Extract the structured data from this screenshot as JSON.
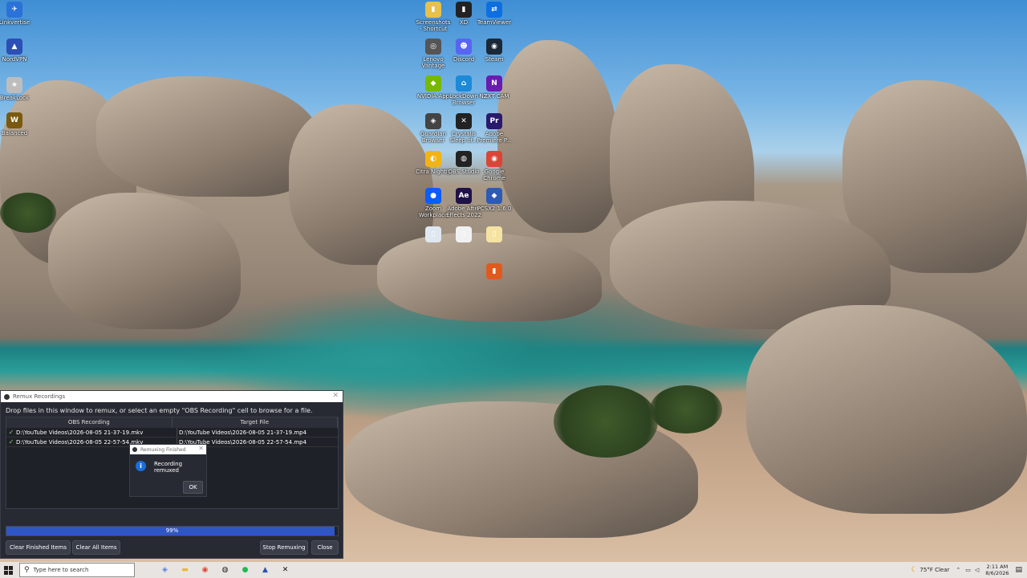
{
  "desktop_icons": [
    {
      "label": "Linkvertise",
      "name": "app-icon-1",
      "glyph": "✈",
      "color": "#2a72d8"
    },
    {
      "label": "NordVPN",
      "name": "nordvpn-icon",
      "glyph": "▲",
      "color": "#2b4fb5"
    },
    {
      "label": "BreakLock",
      "name": "app-icon-3",
      "glyph": "★",
      "color": "#bdbdbd"
    },
    {
      "label": "Balanced",
      "name": "app-icon-4",
      "glyph": "W",
      "color": "#7a5a10"
    },
    {
      "label": "Screenshots - Shortcut",
      "name": "folder-icon",
      "glyph": "▮",
      "color": "#e8c04a"
    },
    {
      "label": "XD",
      "name": "file-icon",
      "glyph": "▮",
      "color": "#222"
    },
    {
      "label": "TeamViewer",
      "name": "teamviewer-icon",
      "glyph": "⇄",
      "color": "#0e6fe0"
    },
    {
      "label": "Lenovo Vantage",
      "name": "vantage-icon",
      "glyph": "◎",
      "color": "#555"
    },
    {
      "label": "Discord",
      "name": "discord-icon",
      "glyph": "☻",
      "color": "#5865f2"
    },
    {
      "label": "Steam",
      "name": "steam-icon",
      "glyph": "◉",
      "color": "#1b2838"
    },
    {
      "label": "NVIDIA App",
      "name": "nvidia-icon",
      "glyph": "◆",
      "color": "#76b900"
    },
    {
      "label": "LockDown Browser",
      "name": "lockdown-icon",
      "glyph": "⌂",
      "color": "#1c8ad8"
    },
    {
      "label": "NZXT CAM",
      "name": "nzxt-icon",
      "glyph": "N",
      "color": "#6a1bb0"
    },
    {
      "label": "Guardian Browser",
      "name": "guardian-icon",
      "glyph": "◈",
      "color": "#444"
    },
    {
      "label": "Crystalis Sleep of...",
      "name": "game-icon",
      "glyph": "✕",
      "color": "#222"
    },
    {
      "label": "Adobe Premiere P...",
      "name": "premiere-icon",
      "glyph": "Pr",
      "color": "#2a1a6e"
    },
    {
      "label": "Citra Nightly",
      "name": "citra-icon",
      "glyph": "◐",
      "color": "#f2b316"
    },
    {
      "label": "OBS Studio",
      "name": "obs-icon",
      "glyph": "◍",
      "color": "#222"
    },
    {
      "label": "Google Chrome",
      "name": "chrome-icon",
      "glyph": "◉",
      "color": "#db4437"
    },
    {
      "label": "Zoom Workplace",
      "name": "zoom-icon",
      "glyph": "●",
      "color": "#0b5cff"
    },
    {
      "label": "Adobe After Effects 2022",
      "name": "aftereffects-icon",
      "glyph": "Ae",
      "color": "#1f1248"
    },
    {
      "label": "PCSX2 1.6.0",
      "name": "pcsx2-icon",
      "glyph": "◆",
      "color": "#2d5ab5"
    },
    {
      "label": "",
      "name": "doc-icon-1",
      "glyph": "▯",
      "color": "#dfe7f1"
    },
    {
      "label": "",
      "name": "doc-icon-2",
      "glyph": "▯",
      "color": "#f1f1f1"
    },
    {
      "label": "",
      "name": "doc-icon-3",
      "glyph": "▯",
      "color": "#f4e3a2"
    },
    {
      "label": "",
      "name": "app-icon-26",
      "glyph": "▮",
      "color": "#e05a1e"
    }
  ],
  "remux": {
    "title": "Remux Recordings",
    "instructions": "Drop files in this window to remux, or select an empty \"OBS Recording\" cell to browse for a file.",
    "columns": [
      "OBS Recording",
      "Target File"
    ],
    "rows": [
      {
        "source": "D:\\YouTube Videos\\2026-08-05 21-37-19.mkv",
        "target": "D:\\YouTube Videos\\2026-08-05 21-37-19.mp4"
      },
      {
        "source": "D:\\YouTube Videos\\2026-08-05 22-57-54.mkv",
        "target": "D:\\YouTube Videos\\2026-08-05 22-57-54.mp4"
      }
    ],
    "progress_label": "99%",
    "progress_value": 0.99,
    "buttons": {
      "clear_finished": "Clear Finished Items",
      "clear_all": "Clear All Items",
      "stop": "Stop Remuxing",
      "close": "Close"
    }
  },
  "message": {
    "title": "Remuxing Finished",
    "text": "Recording remuxed",
    "ok": "OK"
  },
  "taskbar": {
    "search_placeholder": "Type here to search",
    "apps": [
      {
        "name": "copilot-icon",
        "glyph": "◈",
        "color": "#5b7fe0"
      },
      {
        "name": "file-explorer-icon",
        "glyph": "▬",
        "color": "#e8b83a"
      },
      {
        "name": "chrome-taskbar-icon",
        "glyph": "◉",
        "color": "#db4437"
      },
      {
        "name": "obs-taskbar-icon",
        "glyph": "◍",
        "color": "#222"
      },
      {
        "name": "spotify-icon",
        "glyph": "●",
        "color": "#1db954"
      },
      {
        "name": "nordvpn-taskbar-icon",
        "glyph": "▲",
        "color": "#2b4fb5"
      },
      {
        "name": "capcut-icon",
        "glyph": "✕",
        "color": "#111"
      }
    ],
    "weather": "75°F  Clear",
    "time": "2:11 AM",
    "date": "8/6/2026"
  }
}
